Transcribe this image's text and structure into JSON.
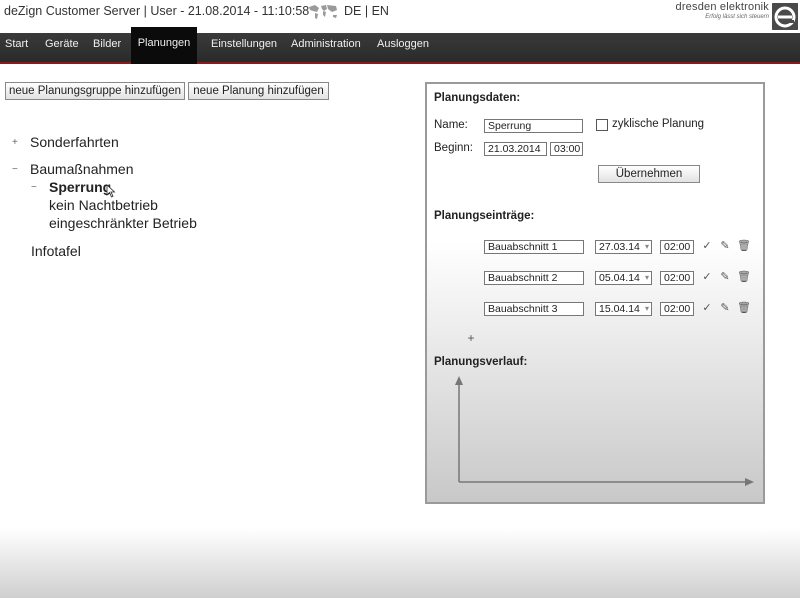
{
  "header": {
    "app_title": "deZign Customer Server | User - 21.08.2014 - 11:10:58",
    "lang_de": "DE",
    "lang_sep": "|",
    "lang_en": "EN",
    "brand_name": "dresden elektronik",
    "brand_tagline": "Erfolg lässt sich steuern",
    "brand_logo_letter": "e"
  },
  "nav": {
    "items": [
      {
        "label": "Start"
      },
      {
        "label": "Geräte"
      },
      {
        "label": "Bilder"
      },
      {
        "label": "Planungen",
        "active": true
      },
      {
        "label": "Einstellungen"
      },
      {
        "label": "Administration"
      },
      {
        "label": "Ausloggen"
      }
    ]
  },
  "actions": {
    "add_group": "neue Planungsgruppe hinzufügen",
    "add_plan": "neue Planung hinzufügen"
  },
  "tree": {
    "expand_symbol": "+",
    "collapse_symbol": "−",
    "items": [
      {
        "label": "Sonderfahrten",
        "state": "collapsed"
      },
      {
        "label": "Baumaßnahmen",
        "state": "expanded"
      },
      {
        "label": "Sperrung",
        "state": "expanded",
        "selected": true
      },
      {
        "label": "kein Nachtbetrieb"
      },
      {
        "label": "eingeschränkter Betrieb"
      },
      {
        "label": "Infotafel"
      }
    ]
  },
  "panel": {
    "data_heading": "Planungsdaten:",
    "name_label": "Name:",
    "name_value": "Sperrung",
    "cyclic_label": "zyklische Planung",
    "cyclic_checked": false,
    "begin_label": "Beginn:",
    "begin_date": "21.03.2014",
    "begin_time": "03:00",
    "apply_button": "Übernehmen",
    "entries_heading": "Planungseinträge:",
    "entries": [
      {
        "name": "Bauabschnitt 1",
        "date": "27.03.14",
        "time": "02:00"
      },
      {
        "name": "Bauabschnitt 2",
        "date": "05.04.14",
        "time": "02:00"
      },
      {
        "name": "Bauabschnitt 3",
        "date": "15.04.14",
        "time": "02:00"
      }
    ],
    "add_entry_symbol": "+",
    "history_heading": "Planungsverlauf:"
  },
  "colors": {
    "nav_bg": "#2f2f2f",
    "nav_active_bg": "#0b0b0b",
    "nav_accent": "#8b1a1a"
  },
  "icons": {
    "confirm": "checkmark-icon",
    "edit": "edit-icon",
    "delete": "trash-icon"
  }
}
